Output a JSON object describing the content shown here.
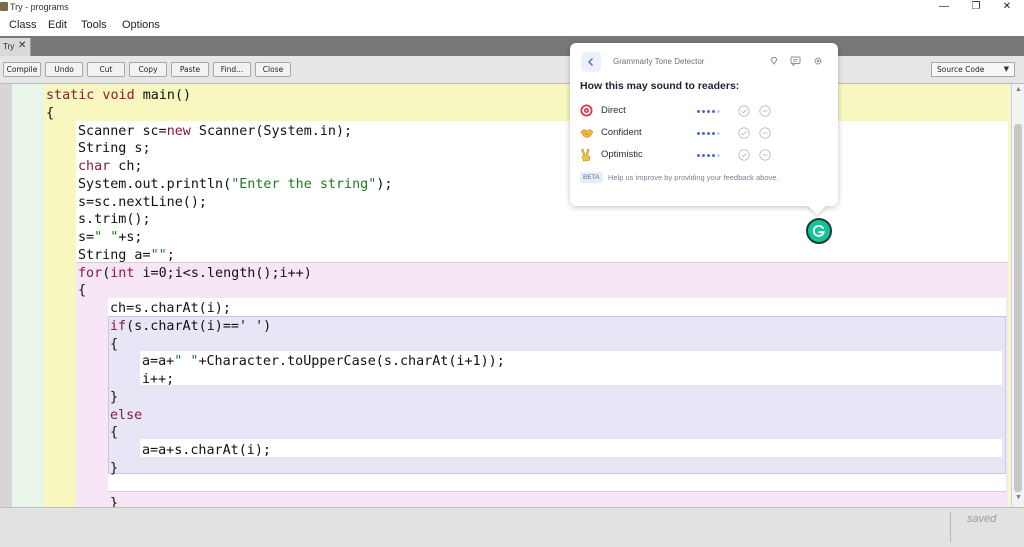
{
  "window": {
    "title": "Try - programs",
    "min_glyph": "—",
    "max_glyph": "❐",
    "close_glyph": "✕"
  },
  "menu": {
    "items": [
      "Class",
      "Edit",
      "Tools",
      "Options"
    ]
  },
  "tab": {
    "label": "Try",
    "close_glyph": "✕"
  },
  "toolbar": {
    "buttons": [
      "Compile",
      "Undo",
      "Cut",
      "Copy",
      "Paste",
      "Find...",
      "Close"
    ],
    "view_select": {
      "value": "Source Code"
    }
  },
  "code": {
    "lines": [
      [
        [
          "kw",
          "static void"
        ],
        [
          "t",
          " main()"
        ]
      ],
      [
        [
          "t",
          "{"
        ]
      ],
      [
        [
          "t",
          "Scanner sc="
        ],
        [
          "kw",
          "new"
        ],
        [
          "t",
          " Scanner(System.in);"
        ]
      ],
      [
        [
          "t",
          "String s;"
        ]
      ],
      [
        [
          "kw",
          "char"
        ],
        [
          "t",
          " ch;"
        ]
      ],
      [
        [
          "t",
          "System.out.println("
        ],
        [
          "str",
          "\"Enter the string\""
        ],
        [
          "t",
          ");"
        ]
      ],
      [
        [
          "t",
          "s=sc.nextLine();"
        ]
      ],
      [
        [
          "t",
          "s.trim();"
        ]
      ],
      [
        [
          "t",
          "s="
        ],
        [
          "str",
          "\" \""
        ],
        [
          "t",
          "+s;"
        ]
      ],
      [
        [
          "t",
          "String a="
        ],
        [
          "str",
          "\"\""
        ],
        [
          "t",
          ";"
        ]
      ],
      [
        [
          "kw",
          "for"
        ],
        [
          "t",
          "("
        ],
        [
          "kw",
          "int"
        ],
        [
          "t",
          " i=0;i<s.length();i++)"
        ]
      ],
      [
        [
          "t",
          "{"
        ]
      ],
      [
        [
          "t",
          "ch=s.charAt(i);"
        ]
      ],
      [
        [
          "kw",
          "if"
        ],
        [
          "t",
          "(s.charAt(i)==' ')"
        ]
      ],
      [
        [
          "t",
          "{"
        ]
      ],
      [
        [
          "t",
          "a=a+"
        ],
        [
          "str",
          "\" \""
        ],
        [
          "t",
          "+Character.toUpperCase(s.charAt(i+1));"
        ]
      ],
      [
        [
          "t",
          "i++;"
        ]
      ],
      [
        [
          "t",
          "}"
        ]
      ],
      [
        [
          "kw",
          "else"
        ]
      ],
      [
        [
          "t",
          "{"
        ]
      ],
      [
        [
          "t",
          "a=a+s.charAt(i);"
        ]
      ],
      [
        [
          "t",
          "}"
        ]
      ],
      [
        [
          "t",
          ""
        ]
      ],
      [
        [
          "t",
          "}"
        ]
      ]
    ]
  },
  "status": {
    "text": "saved"
  },
  "grammarly": {
    "title": "Grammarly Tone Detector",
    "heading": "How this may sound to readers:",
    "tones": [
      {
        "label": "Direct",
        "emoji": "direct-target-icon",
        "level": 4
      },
      {
        "label": "Confident",
        "emoji": "confident-handshake-icon",
        "level": 4
      },
      {
        "label": "Optimistic",
        "emoji": "optimistic-victory-hand-icon",
        "level": 4
      }
    ],
    "beta_label": "BETA",
    "feedback_text": "Help us improve by providing your feedback above.",
    "accent": "#15c39a"
  }
}
